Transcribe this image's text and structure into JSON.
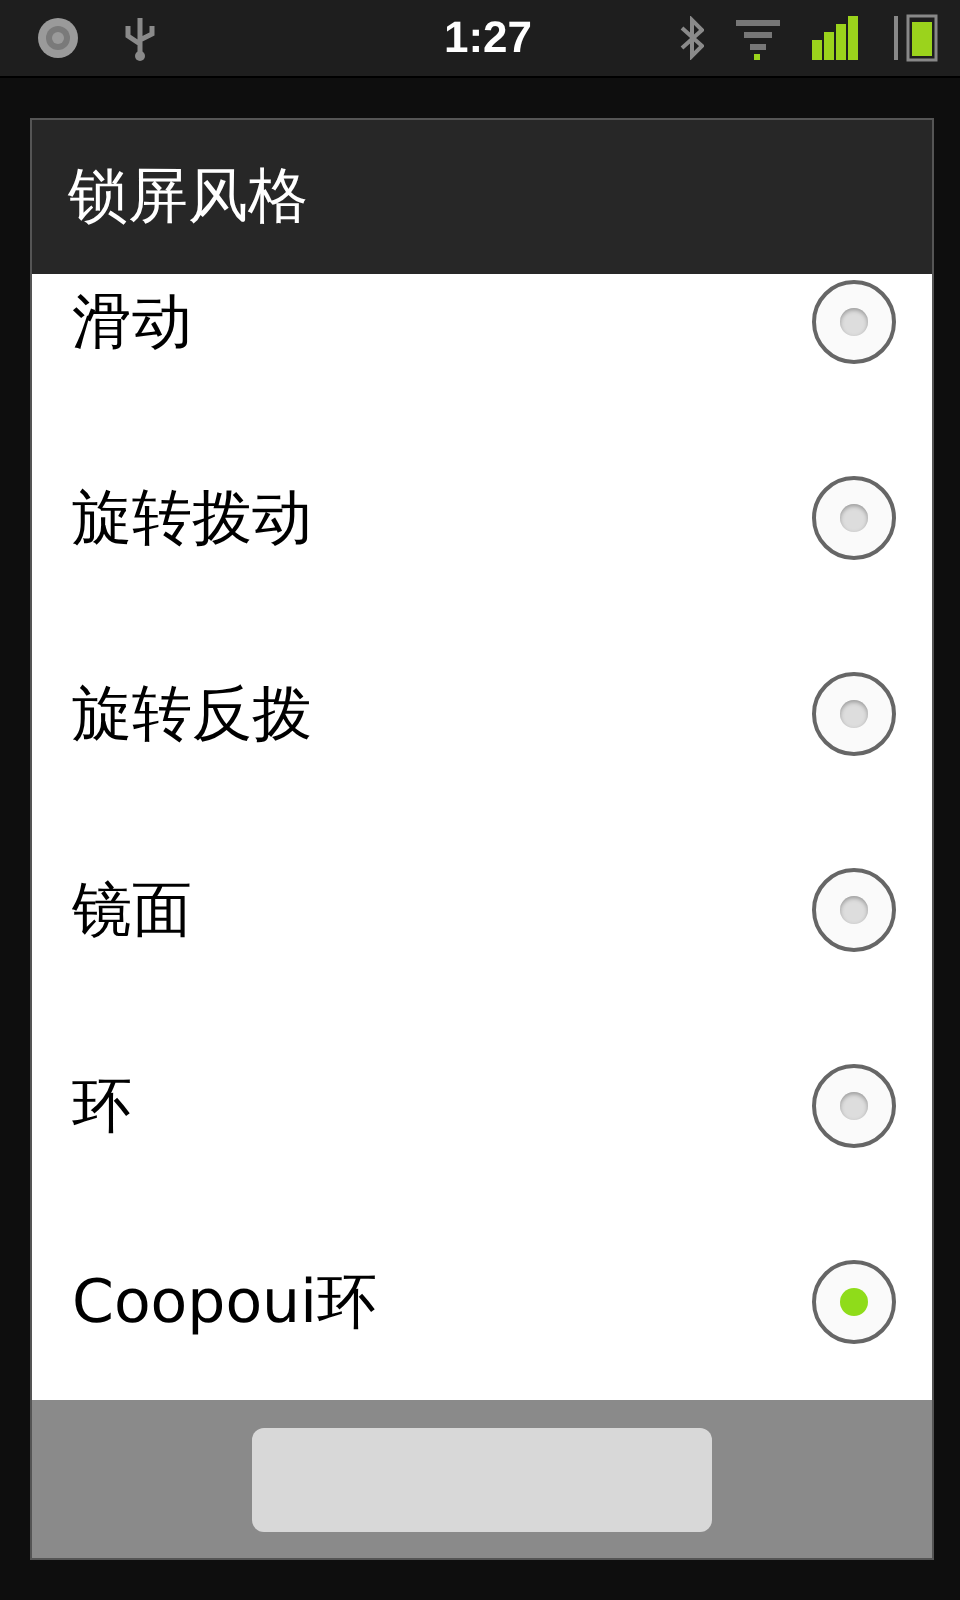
{
  "status_bar": {
    "time": "1:27"
  },
  "dialog": {
    "title": "锁屏风格",
    "options": [
      {
        "label": "滑动",
        "selected": false
      },
      {
        "label": "旋转拨动",
        "selected": false
      },
      {
        "label": "旋转反拨",
        "selected": false
      },
      {
        "label": "镜面",
        "selected": false
      },
      {
        "label": "环",
        "selected": false
      },
      {
        "label": "Coopoui环",
        "selected": true
      }
    ]
  }
}
